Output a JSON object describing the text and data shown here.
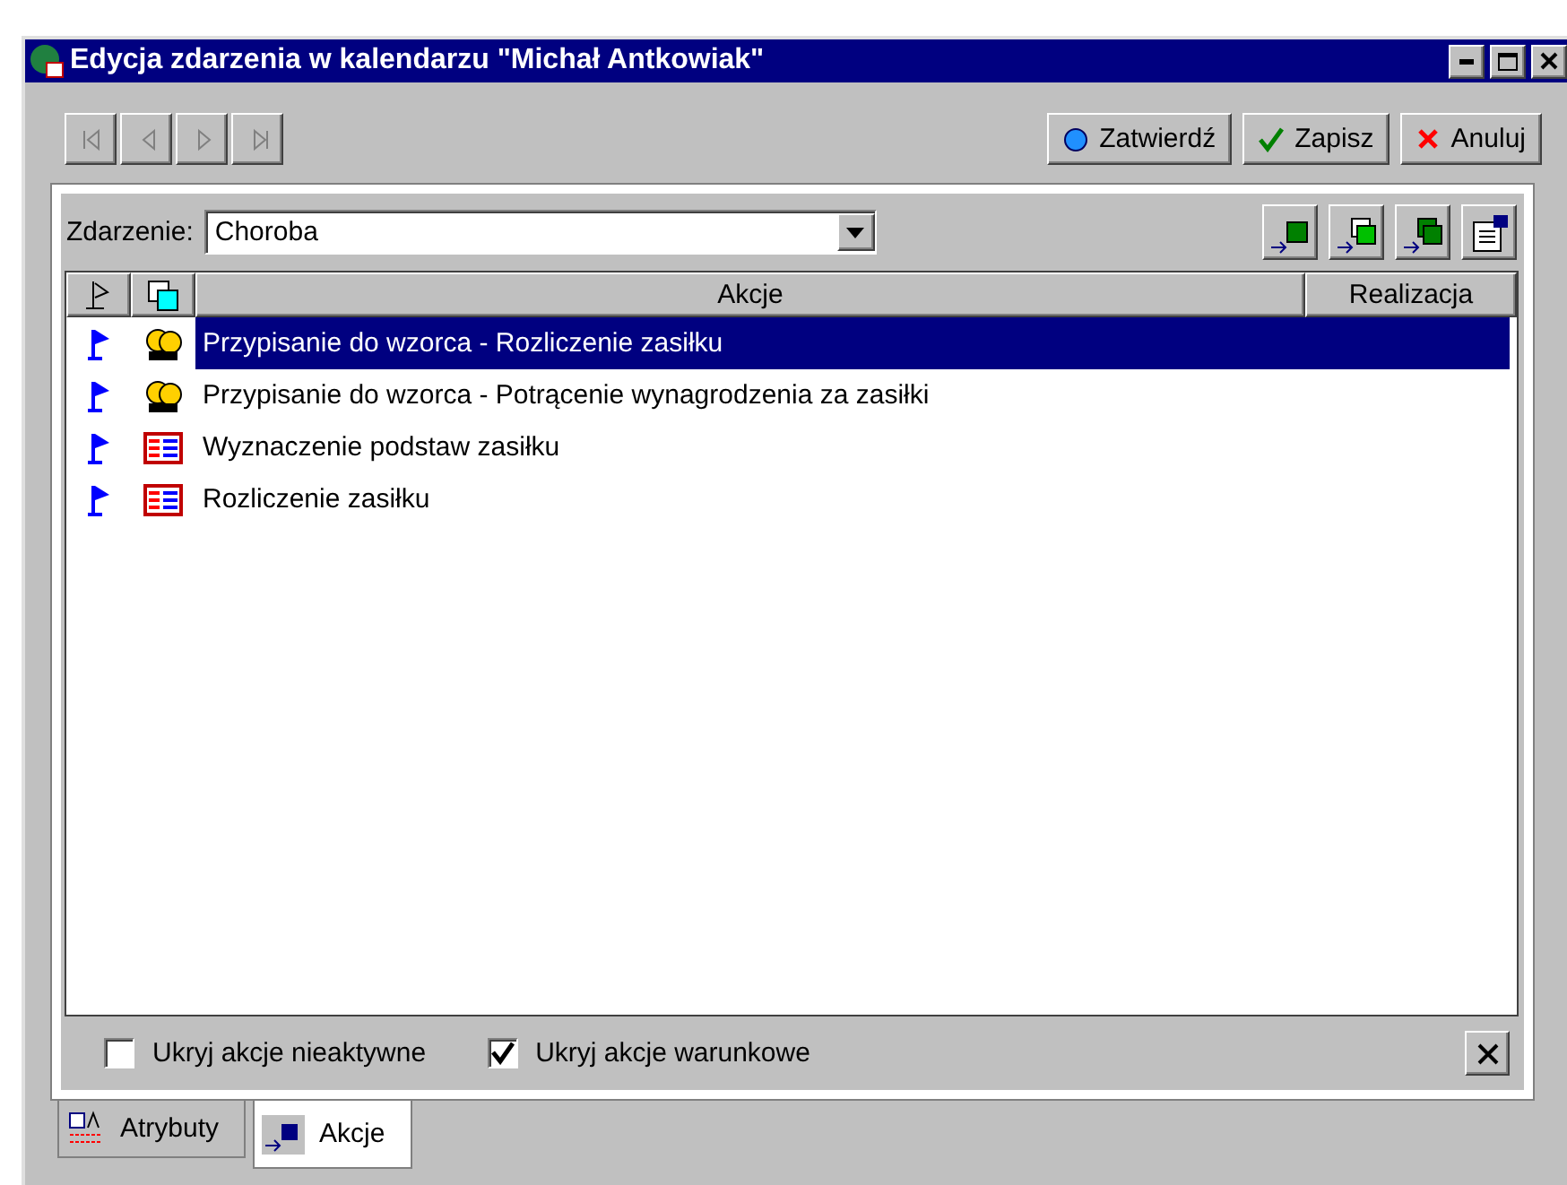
{
  "window": {
    "title": "Edycja zdarzenia w kalendarzu \"Michał Antkowiak\""
  },
  "nav_buttons": [
    {
      "kind": "first",
      "disabled": true
    },
    {
      "kind": "prev",
      "disabled": true
    },
    {
      "kind": "next",
      "disabled": true
    },
    {
      "kind": "last",
      "disabled": true
    }
  ],
  "action_buttons": [
    {
      "kind": "confirm",
      "label": "Zatwierdź"
    },
    {
      "kind": "save",
      "label": "Zapisz"
    },
    {
      "kind": "cancel",
      "label": "Anuluj"
    }
  ],
  "event": {
    "label": "Zdarzenie:",
    "value": "Choroba"
  },
  "tool_buttons": [
    {
      "kind": "add"
    },
    {
      "kind": "copy"
    },
    {
      "kind": "copy-dark"
    },
    {
      "kind": "properties"
    }
  ],
  "table": {
    "columns": [
      {
        "kind": "flag"
      },
      {
        "kind": "type"
      },
      {
        "kind": "text",
        "label": "Akcje"
      },
      {
        "kind": "text",
        "label": "Realizacja"
      }
    ],
    "rows": [
      {
        "kind": "people",
        "text": "Przypisanie do wzorca - Rozliczenie zasiłku",
        "selected": true
      },
      {
        "kind": "people",
        "text": "Przypisanie do wzorca - Potrącenie wynagrodzenia za zasiłki",
        "selected": false
      },
      {
        "kind": "form",
        "text": "Wyznaczenie podstaw zasiłku",
        "selected": false
      },
      {
        "kind": "form",
        "text": "Rozliczenie zasiłku",
        "selected": false
      }
    ]
  },
  "options": [
    {
      "label": "Ukryj akcje nieaktywne",
      "checked": false
    },
    {
      "label": "Ukryj akcje warunkowe",
      "checked": true
    }
  ],
  "tabs": [
    {
      "kind": "attributes",
      "label": "Atrybuty",
      "selected": false
    },
    {
      "kind": "actions",
      "label": "Akcje",
      "selected": true
    }
  ]
}
